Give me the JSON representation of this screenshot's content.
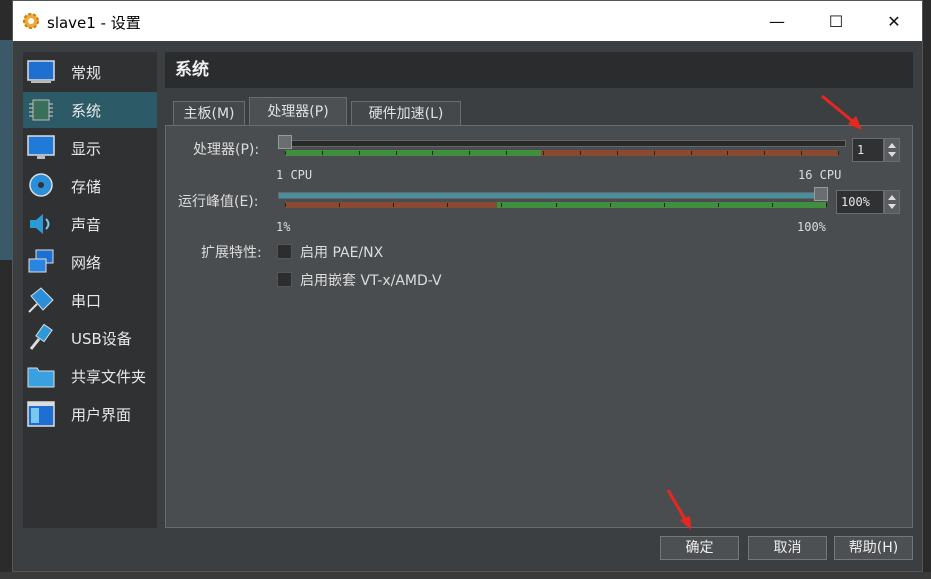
{
  "window": {
    "title": "slave1 - 设置"
  },
  "window_controls": {
    "minimize": "—",
    "maximize": "☐",
    "close": "✕"
  },
  "sidebar": {
    "items": [
      {
        "label": "常规",
        "icon": "general-icon"
      },
      {
        "label": "系统",
        "icon": "system-chip-icon"
      },
      {
        "label": "显示",
        "icon": "display-icon"
      },
      {
        "label": "存储",
        "icon": "storage-icon"
      },
      {
        "label": "声音",
        "icon": "audio-icon"
      },
      {
        "label": "网络",
        "icon": "network-icon"
      },
      {
        "label": "串口",
        "icon": "serial-port-icon"
      },
      {
        "label": "USB设备",
        "icon": "usb-icon"
      },
      {
        "label": "共享文件夹",
        "icon": "shared-folder-icon"
      },
      {
        "label": "用户界面",
        "icon": "user-interface-icon"
      }
    ],
    "selected": "系统"
  },
  "section_title": "系统",
  "tabs": [
    {
      "label": "主板(M)"
    },
    {
      "label": "处理器(P)",
      "active": true
    },
    {
      "label": "硬件加速(L)"
    }
  ],
  "processor": {
    "label": "处理器(P):",
    "value": "1",
    "min_label": "1 CPU",
    "max_label": "16 CPU",
    "level": 0.0
  },
  "exec_cap": {
    "label": "运行峰值(E):",
    "value": "100%",
    "min_label": "1%",
    "max_label": "100%",
    "level": 1.0
  },
  "extended": {
    "label": "扩展特性:",
    "pae": {
      "label": "启用 PAE/NX",
      "checked": false
    },
    "nested": {
      "label": "启用嵌套 VT-x/AMD-V",
      "checked": false
    }
  },
  "buttons": {
    "ok": "确定",
    "cancel": "取消",
    "help": "帮助(H)"
  },
  "colors": {
    "selection": "#2c5a66",
    "green": "#3f8f3f",
    "red": "#8a4a32",
    "annotation_arrow": "#e8281e"
  }
}
